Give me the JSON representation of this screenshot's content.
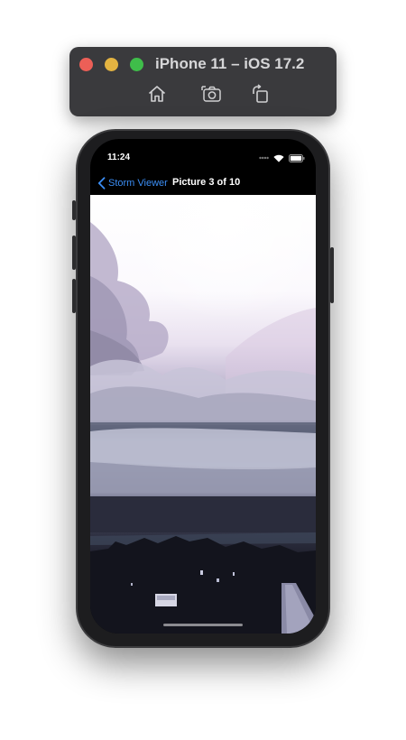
{
  "simulator": {
    "title": "iPhone 11 – iOS 17.2",
    "traffic_colors": {
      "close": "#ec5f57",
      "minimize": "#e3b341",
      "zoom": "#3fbd4a"
    },
    "toolbar": [
      "home-icon",
      "screenshot-icon",
      "rotate-icon"
    ]
  },
  "status_bar": {
    "time": "11:24",
    "icons": [
      "signal-dots-icon",
      "wifi-icon",
      "battery-icon"
    ]
  },
  "nav_bar": {
    "back_label": "Storm Viewer",
    "title": "Picture 3 of 10",
    "tint_color": "#3b8ef5"
  },
  "content": {
    "image": "storm-clouds-photo"
  }
}
